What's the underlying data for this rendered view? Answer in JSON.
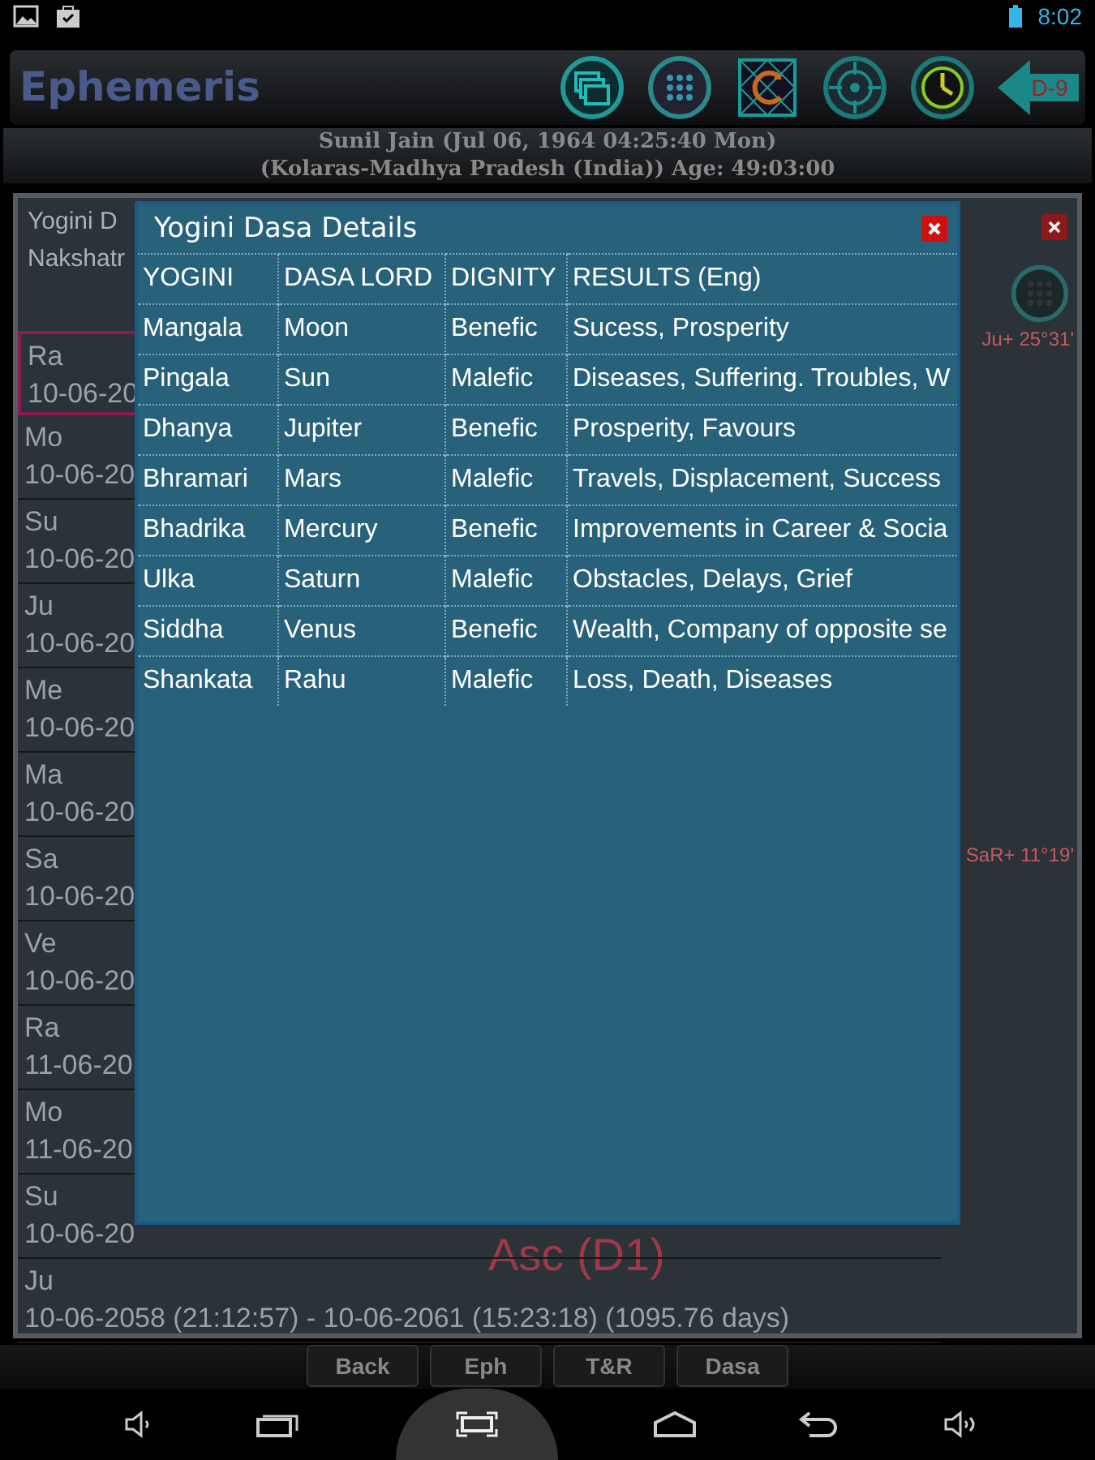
{
  "status_bar": {
    "time": "8:02"
  },
  "app_bar": {
    "title": "Ephemeris",
    "chart_button": "D-9"
  },
  "subject": {
    "line_1": "Sunil Jain (Jul 06, 1964 04:25:40 Mon)",
    "line_2": "(Kolaras-Madhya Pradesh (India)) Age: 49:03:00"
  },
  "panel": {
    "title": "Yogini D",
    "subtitle": "Nakshatr",
    "chart_labels": [
      {
        "text": "Ju+ 25°31'",
        "kind": "planet"
      },
      {
        "text": "SaR+ 11°19'",
        "kind": "planet"
      },
      {
        "text": "Asc (D1)",
        "kind": "chart_title"
      }
    ],
    "rows": [
      {
        "lord": "Ra",
        "period": "10-06-20",
        "selected": true
      },
      {
        "lord": "Mo",
        "period": "10-06-20",
        "selected": false
      },
      {
        "lord": "Su",
        "period": "10-06-20",
        "selected": false
      },
      {
        "lord": "Ju",
        "period": "10-06-20",
        "selected": false
      },
      {
        "lord": "Me",
        "period": "10-06-20",
        "selected": false
      },
      {
        "lord": "Ma",
        "period": "10-06-20",
        "selected": false
      },
      {
        "lord": "Sa",
        "period": "10-06-20",
        "selected": false
      },
      {
        "lord": "Ve",
        "period": "10-06-20",
        "selected": false
      },
      {
        "lord": "Ra",
        "period": "11-06-20",
        "selected": false
      },
      {
        "lord": "Mo",
        "period": "11-06-20",
        "selected": false
      },
      {
        "lord": "Su",
        "period": "10-06-20",
        "selected": false
      },
      {
        "lord": "Ju",
        "period": "10-06-2058 (21:12:57) - 10-06-2061 (15:23:18) (1095.76 days)",
        "selected": false
      }
    ]
  },
  "dialog": {
    "title": "Yogini Dasa Details",
    "columns": [
      "YOGINI",
      "DASA LORD",
      "DIGNITY",
      "RESULTS (Eng)"
    ],
    "rows": [
      [
        "Mangala",
        "Moon",
        "Benefic",
        "Sucess, Prosperity"
      ],
      [
        "Pingala",
        "Sun",
        "Malefic",
        "Diseases, Suffering. Troubles, W"
      ],
      [
        "Dhanya",
        "Jupiter",
        "Benefic",
        "Prosperity, Favours"
      ],
      [
        "Bhramari",
        "Mars",
        "Malefic",
        "Travels, Displacement, Success"
      ],
      [
        "Bhadrika",
        "Mercury",
        "Benefic",
        "Improvements in Career & Socia"
      ],
      [
        "Ulka",
        "Saturn",
        "Malefic",
        "Obstacles, Delays, Grief"
      ],
      [
        "Siddha",
        "Venus",
        "Benefic",
        "Wealth, Company of opposite se"
      ],
      [
        "Shankata",
        "Rahu",
        "Malefic",
        "Loss, Death, Diseases"
      ]
    ]
  },
  "buttons": [
    "Back",
    "Eph",
    "T&R",
    "Dasa"
  ]
}
